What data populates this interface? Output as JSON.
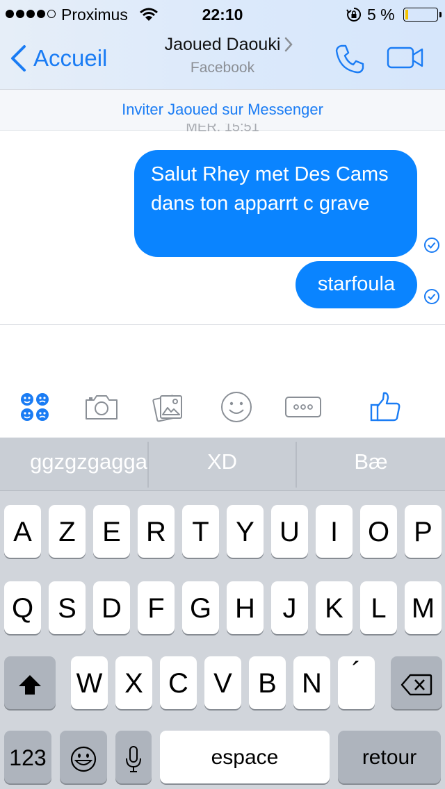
{
  "status_bar": {
    "carrier": "Proximus",
    "time": "22:10",
    "battery_percent": "5 %",
    "battery_level": 0.05
  },
  "header": {
    "back_label": "Accueil",
    "contact_name": "Jaoued Daouki",
    "contact_source": "Facebook",
    "accent_color": "#1a7cf4"
  },
  "invite_banner": {
    "text": "Inviter Jaoued sur Messenger"
  },
  "conversation": {
    "day_stamp": "MER. 15:51",
    "messages": [
      {
        "text": "Salut Rhey met Des Cams dans ton apparrt c grave",
        "status": "sent"
      },
      {
        "text": "starfoula",
        "status": "sent"
      }
    ],
    "bubble_color": "#0a84ff"
  },
  "composer_tools": [
    "emoji-grid-icon",
    "camera-icon",
    "gallery-icon",
    "smiley-icon",
    "more-icon",
    "thumbs-up-icon"
  ],
  "keyboard": {
    "predictions": [
      "ggzgzgagga",
      "XD",
      "Bæ"
    ],
    "row1": [
      "A",
      "Z",
      "E",
      "R",
      "T",
      "Y",
      "U",
      "I",
      "O",
      "P"
    ],
    "row2": [
      "Q",
      "S",
      "D",
      "F",
      "G",
      "H",
      "J",
      "K",
      "L",
      "M"
    ],
    "row3": [
      "W",
      "X",
      "C",
      "V",
      "B",
      "N",
      "´"
    ],
    "numbers_label": "123",
    "space_label": "espace",
    "return_label": "retour"
  }
}
